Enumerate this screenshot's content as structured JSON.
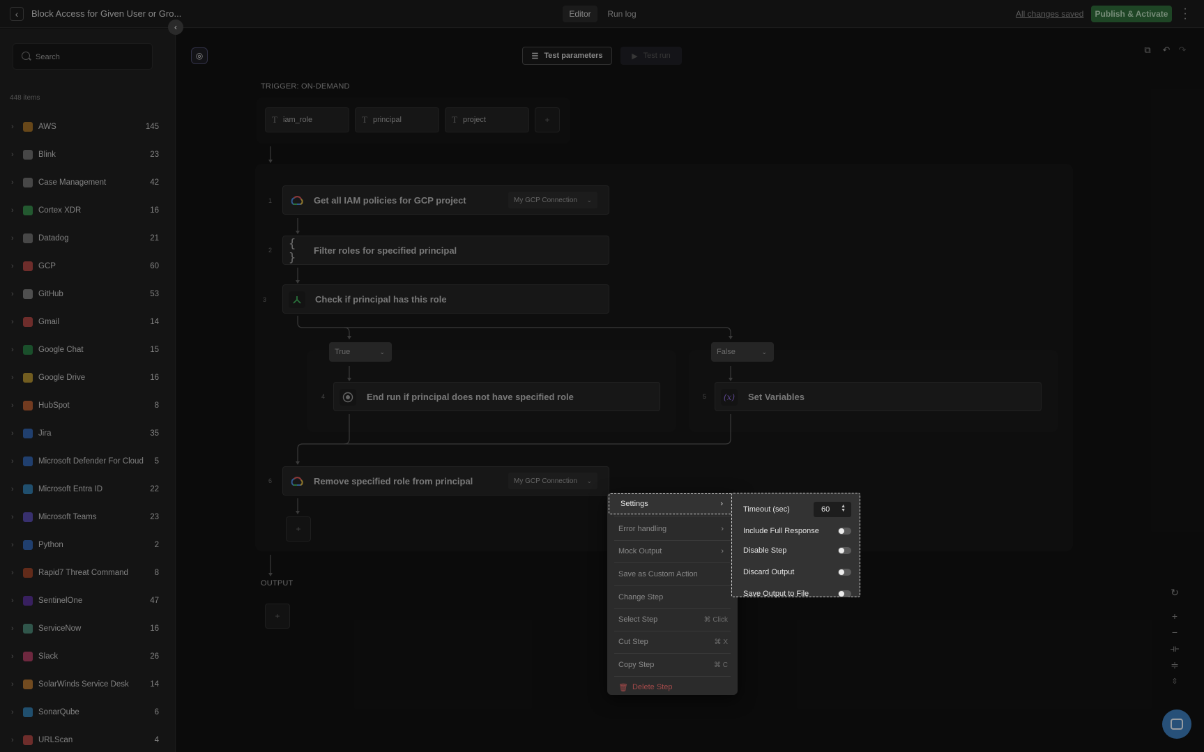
{
  "topbar": {
    "title": "Block Access for Given User or Gro...",
    "tabs": [
      "Editor",
      "Run log"
    ],
    "status": "All changes saved",
    "publish_label": "Publish & Activate"
  },
  "sidebar": {
    "search_placeholder": "Search",
    "items_count": "448 items",
    "apps": [
      {
        "name": "AWS",
        "count": "145",
        "color": "#c98a2b"
      },
      {
        "name": "Blink",
        "count": "23",
        "color": "#8a8a8a"
      },
      {
        "name": "Case Management",
        "count": "42",
        "color": "#8a8a8a"
      },
      {
        "name": "Cortex XDR",
        "count": "16",
        "color": "#3fae5a"
      },
      {
        "name": "Datadog",
        "count": "21",
        "color": "#8a8a8a"
      },
      {
        "name": "GCP",
        "count": "60",
        "color": "#d9534f"
      },
      {
        "name": "GitHub",
        "count": "53",
        "color": "#9a9a9a"
      },
      {
        "name": "Gmail",
        "count": "14",
        "color": "#d9534f"
      },
      {
        "name": "Google Chat",
        "count": "15",
        "color": "#2e9a4f"
      },
      {
        "name": "Google Drive",
        "count": "16",
        "color": "#e0b63a"
      },
      {
        "name": "HubSpot",
        "count": "8",
        "color": "#e0703a"
      },
      {
        "name": "Jira",
        "count": "35",
        "color": "#3a7ad9"
      },
      {
        "name": "Microsoft Defender For Cloud",
        "count": "5",
        "color": "#3a7ad9"
      },
      {
        "name": "Microsoft Entra ID",
        "count": "22",
        "color": "#3a9ad9"
      },
      {
        "name": "Microsoft Teams",
        "count": "23",
        "color": "#6a5ad9"
      },
      {
        "name": "Python",
        "count": "2",
        "color": "#3a7ad9"
      },
      {
        "name": "Rapid7 Threat Command",
        "count": "8",
        "color": "#c0502e"
      },
      {
        "name": "SentinelOne",
        "count": "47",
        "color": "#6a3ab9"
      },
      {
        "name": "ServiceNow",
        "count": "16",
        "color": "#5aa890"
      },
      {
        "name": "Slack",
        "count": "26",
        "color": "#d94a7a"
      },
      {
        "name": "SolarWinds Service Desk",
        "count": "14",
        "color": "#e0903a"
      },
      {
        "name": "SonarQube",
        "count": "6",
        "color": "#3a9ad9"
      },
      {
        "name": "URLScan",
        "count": "4",
        "color": "#d9534f"
      }
    ]
  },
  "canvas": {
    "test_params_label": "Test parameters",
    "test_run_label": "Test run",
    "trigger_label": "TRIGGER: ON-DEMAND",
    "params": [
      "iam_role",
      "principal",
      "project"
    ],
    "output_label": "OUTPUT",
    "steps": [
      {
        "num": "1",
        "title": "Get all IAM policies for GCP project",
        "connection": "My GCP Connection",
        "icon": "gcp-icon"
      },
      {
        "num": "2",
        "title": "Filter roles for specified principal",
        "icon": "braces-icon"
      },
      {
        "num": "3",
        "title": "Check if principal has this role",
        "icon": "branch-icon"
      },
      {
        "num": "4",
        "title": "End run if principal does not have specified role",
        "icon": "stop-icon"
      },
      {
        "num": "5",
        "title": "Set Variables",
        "icon": "variable-icon"
      },
      {
        "num": "6",
        "title": "Remove specified role from principal",
        "connection": "My GCP Connection",
        "icon": "gcp-icon"
      }
    ],
    "conditions": {
      "true_label": "True",
      "false_label": "False"
    }
  },
  "context_menu": {
    "items": [
      {
        "label": "Settings",
        "submenu": true
      },
      {
        "label": "Error handling",
        "submenu": true
      },
      {
        "label": "Mock Output",
        "submenu": true
      },
      {
        "label": "Save as Custom Action"
      },
      {
        "label": "Change Step"
      },
      {
        "label": "Select Step",
        "shortcut": "⌘ Click"
      },
      {
        "label": "Cut Step",
        "shortcut": "⌘ X"
      },
      {
        "label": "Copy Step",
        "shortcut": "⌘ C"
      },
      {
        "label": "Delete Step"
      }
    ]
  },
  "settings_submenu": {
    "timeout_label": "Timeout (sec)",
    "timeout_value": "60",
    "toggles": [
      {
        "label": "Include Full Response",
        "on": false
      },
      {
        "label": "Disable Step",
        "on": false
      },
      {
        "label": "Discard Output",
        "on": false
      },
      {
        "label": "Save Output to File",
        "on": false
      }
    ]
  }
}
